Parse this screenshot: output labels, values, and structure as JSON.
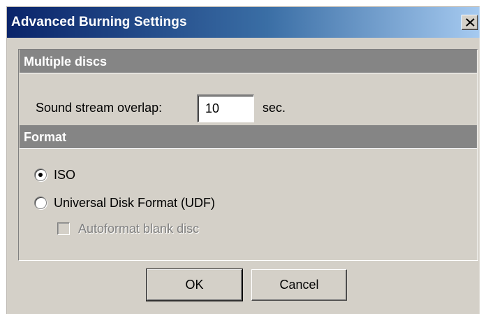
{
  "window": {
    "title": "Advanced Burning Settings",
    "close_glyph": "X"
  },
  "multiple_discs": {
    "header": "Multiple discs",
    "overlap_label": "Sound stream overlap:",
    "overlap_value": "10",
    "overlap_unit": "sec."
  },
  "format": {
    "header": "Format",
    "options": [
      {
        "label": "ISO",
        "selected": true
      },
      {
        "label": "Universal Disk Format (UDF)",
        "selected": false
      }
    ],
    "autoformat_label": "Autoformat blank disc",
    "autoformat_checked": false,
    "autoformat_enabled": false
  },
  "buttons": {
    "ok": "OK",
    "cancel": "Cancel"
  },
  "colors": {
    "title_start": "#0a246a",
    "title_end": "#a6caf0",
    "section_header": "#858585",
    "face": "#d4d0c8"
  },
  "icons": {
    "close": "close-icon"
  }
}
